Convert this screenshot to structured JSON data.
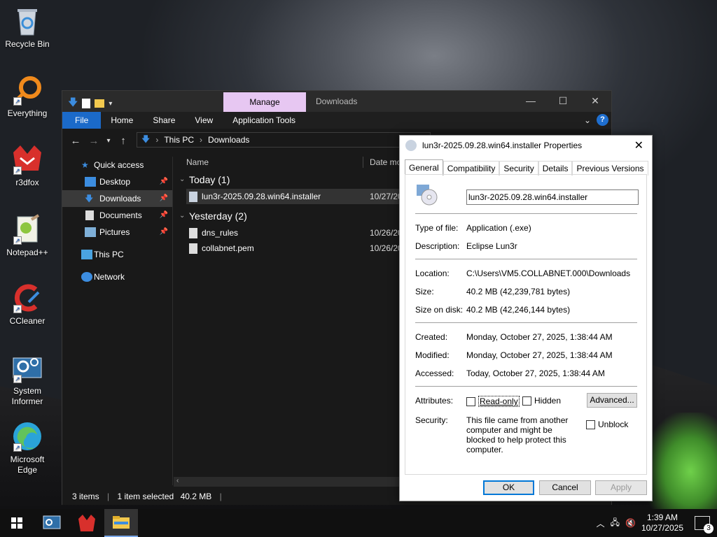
{
  "desktop": {
    "icons": [
      {
        "name": "recycle-bin-icon",
        "label": "Recycle Bin"
      },
      {
        "name": "everything-icon",
        "label": "Everything"
      },
      {
        "name": "r3dfox-icon",
        "label": "r3dfox"
      },
      {
        "name": "notepadpp-icon",
        "label": "Notepad++"
      },
      {
        "name": "ccleaner-icon",
        "label": "CCleaner"
      },
      {
        "name": "system-informer-icon",
        "label": "System Informer"
      },
      {
        "name": "edge-icon",
        "label": "Microsoft Edge"
      }
    ]
  },
  "explorer": {
    "title": "Downloads",
    "manage_tab": "Manage",
    "ribbon": {
      "file": "File",
      "home": "Home",
      "share": "Share",
      "view": "View",
      "app_tools": "Application Tools"
    },
    "breadcrumb": {
      "part1": "This PC",
      "part2": "Downloads"
    },
    "sidebar": {
      "quick_access": "Quick access",
      "desktop": "Desktop",
      "downloads": "Downloads",
      "documents": "Documents",
      "pictures": "Pictures",
      "this_pc": "This PC",
      "network": "Network"
    },
    "columns": {
      "name": "Name",
      "date": "Date mo"
    },
    "groups": {
      "today": "Today (1)",
      "yesterday": "Yesterday (2)"
    },
    "files": {
      "f1": {
        "name": "lun3r-2025.09.28.win64.installer",
        "date": "10/27/20"
      },
      "f2": {
        "name": "dns_rules",
        "date": "10/26/20"
      },
      "f3": {
        "name": "collabnet.pem",
        "date": "10/26/20"
      }
    },
    "status": {
      "items": "3 items",
      "selected": "1 item selected",
      "size": "40.2 MB"
    }
  },
  "properties": {
    "title": "lun3r-2025.09.28.win64.installer Properties",
    "tabs": {
      "general": "General",
      "compatibility": "Compatibility",
      "security": "Security",
      "details": "Details",
      "previous": "Previous Versions"
    },
    "filename": "lun3r-2025.09.28.win64.installer",
    "labels": {
      "type": "Type of file:",
      "description": "Description:",
      "location": "Location:",
      "size": "Size:",
      "size_on_disk": "Size on disk:",
      "created": "Created:",
      "modified": "Modified:",
      "accessed": "Accessed:",
      "attributes": "Attributes:",
      "security": "Security:"
    },
    "values": {
      "type": "Application (.exe)",
      "description": "Eclipse Lun3r",
      "location": "C:\\Users\\VM5.COLLABNET.000\\Downloads",
      "size": "40.2 MB (42,239,781 bytes)",
      "size_on_disk": "40.2 MB (42,246,144 bytes)",
      "created": "Monday, October 27, 2025, 1:38:44 AM",
      "modified": "Monday, October 27, 2025, 1:38:44 AM",
      "accessed": "Today, October 27, 2025, 1:38:44 AM",
      "security_text": "This file came from another computer and might be blocked to help protect this computer."
    },
    "checks": {
      "readonly": "Read-only",
      "hidden": "Hidden",
      "unblock": "Unblock"
    },
    "buttons": {
      "advanced": "Advanced...",
      "ok": "OK",
      "cancel": "Cancel",
      "apply": "Apply"
    }
  },
  "taskbar": {
    "time": "1:39 AM",
    "date": "10/27/2025",
    "notifications": "3"
  },
  "colors": {
    "accent": "#1b6ac9",
    "manage": "#e7c7f2"
  }
}
